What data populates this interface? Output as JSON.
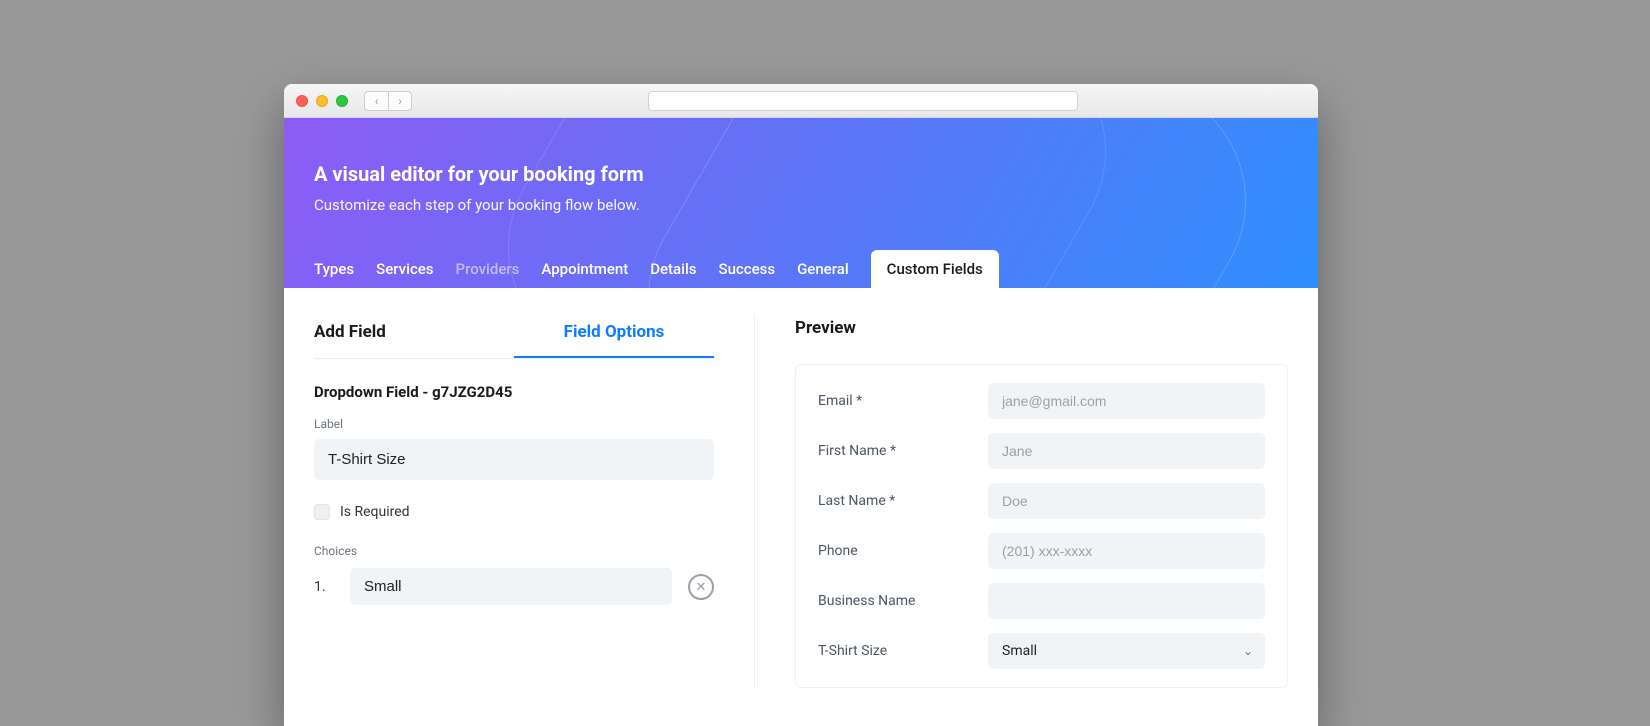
{
  "hero": {
    "title": "A visual editor for your booking form",
    "subtitle": "Customize each step of your booking flow below."
  },
  "tabs": [
    {
      "label": "Types",
      "state": "normal"
    },
    {
      "label": "Services",
      "state": "normal"
    },
    {
      "label": "Providers",
      "state": "faded"
    },
    {
      "label": "Appointment",
      "state": "normal"
    },
    {
      "label": "Details",
      "state": "normal"
    },
    {
      "label": "Success",
      "state": "normal"
    },
    {
      "label": "General",
      "state": "normal"
    },
    {
      "label": "Custom Fields",
      "state": "active"
    }
  ],
  "subtabs": {
    "left": "Add Field",
    "right": "Field Options",
    "active": "right"
  },
  "field": {
    "heading": "Dropdown Field - g7JZG2D45",
    "label_label": "Label",
    "label_value": "T-Shirt Size",
    "required_label": "Is Required",
    "required_checked": false,
    "choices_label": "Choices",
    "choices": [
      {
        "num": "1.",
        "value": "Small"
      }
    ]
  },
  "preview": {
    "title": "Preview",
    "rows": [
      {
        "label": "Email *",
        "placeholder": "jane@gmail.com",
        "value": ""
      },
      {
        "label": "First Name *",
        "placeholder": "Jane",
        "value": ""
      },
      {
        "label": "Last Name *",
        "placeholder": "Doe",
        "value": ""
      },
      {
        "label": "Phone",
        "placeholder": "(201) xxx-xxxx",
        "value": ""
      },
      {
        "label": "Business Name",
        "placeholder": "",
        "value": ""
      }
    ],
    "select_row": {
      "label": "T-Shirt Size",
      "selected": "Small"
    }
  }
}
